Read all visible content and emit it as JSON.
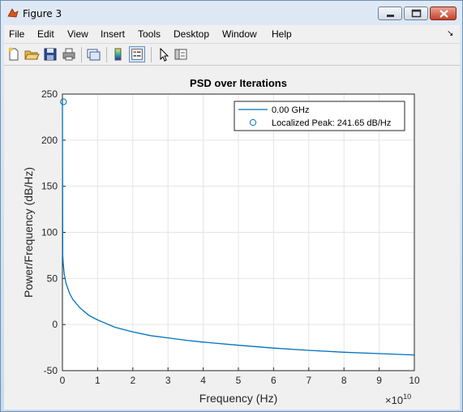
{
  "window": {
    "title": "Figure 3",
    "controls": [
      "minimize-icon",
      "maximize-icon",
      "close-icon"
    ]
  },
  "menubar": {
    "items": [
      "File",
      "Edit",
      "View",
      "Insert",
      "Tools",
      "Desktop",
      "Window",
      "Help"
    ]
  },
  "toolbar": {
    "icons": [
      "new-figure-icon",
      "open-file-icon",
      "save-icon",
      "print-icon",
      "link-plot-icon",
      "colorbar-icon",
      "legend-icon",
      "pointer-icon",
      "property-editor-icon"
    ],
    "pressed": "legend-icon"
  },
  "chart_data": {
    "type": "line",
    "title": "PSD over Iterations",
    "xlabel": "Frequency (Hz)",
    "ylabel": "Power/Frequency (dB/Hz)",
    "x_exponent_label": "×10",
    "x_exponent_power": "10",
    "xlim": [
      0,
      10
    ],
    "ylim": [
      -50,
      250
    ],
    "xticks": [
      "0",
      "1",
      "2",
      "3",
      "4",
      "5",
      "6",
      "7",
      "8",
      "9",
      "10"
    ],
    "yticks": [
      "-50",
      "0",
      "50",
      "100",
      "150",
      "200",
      "250"
    ],
    "grid": true,
    "legend_placement": "top-right",
    "series": [
      {
        "name": "0.00 GHz",
        "color": "#0072bd",
        "x": [
          0,
          0.005,
          0.01,
          0.02,
          0.05,
          0.1,
          0.2,
          0.3,
          0.5,
          0.75,
          1,
          1.5,
          2,
          2.5,
          3,
          3.5,
          4,
          5,
          6,
          7,
          8,
          9,
          10
        ],
        "y": [
          241.65,
          168,
          75,
          67,
          55,
          45,
          34,
          27,
          18,
          10,
          5,
          -3,
          -8,
          -12,
          -14.5,
          -17,
          -19,
          -22.5,
          -25.5,
          -28,
          -30,
          -31.5,
          -33
        ]
      }
    ],
    "marker": {
      "name": "Localized Peak: 241.65 dB/Hz",
      "x": 0.03,
      "y": 241.65,
      "symbol": "circle",
      "color": "#0072bd"
    }
  }
}
